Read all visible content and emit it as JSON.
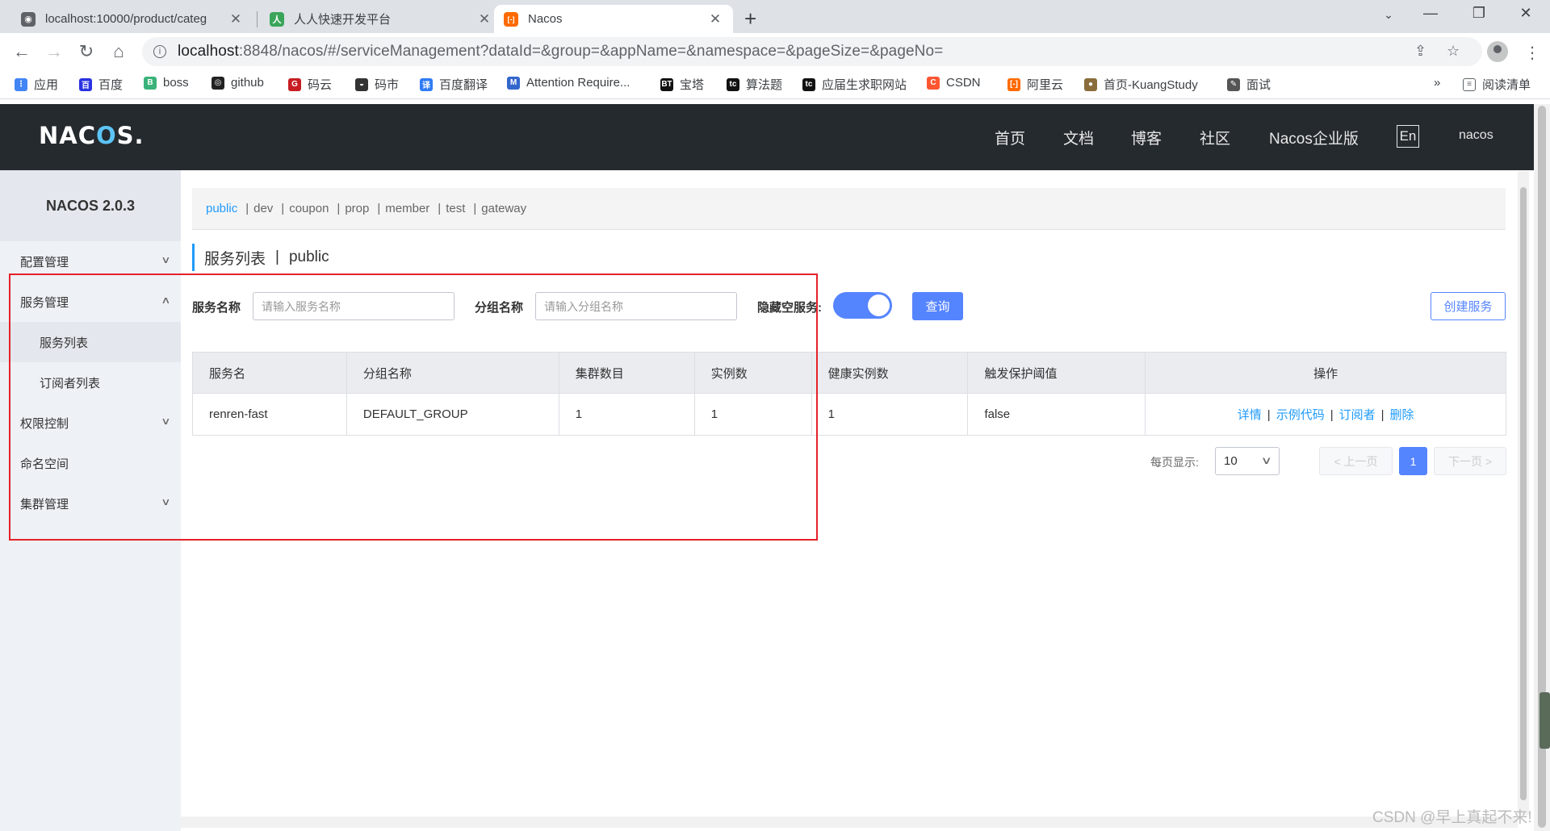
{
  "browser": {
    "tabs": [
      {
        "title": "localhost:10000/product/categ",
        "fav_color": "#5f6368",
        "fav_glyph": "◉"
      },
      {
        "title": "人人快速开发平台",
        "fav_color": "#3aa55a",
        "fav_glyph": "人"
      },
      {
        "title": "Nacos",
        "fav_color": "#ff6a00",
        "fav_glyph": "[-]"
      }
    ],
    "url_host": "localhost",
    "url_rest": ":8848/nacos/#/serviceManagement?dataId=&group=&appName=&namespace=&pageSize=&pageNo=",
    "bookmarks": [
      {
        "label": "应用",
        "color": "#4285f4",
        "glyph": "⋮"
      },
      {
        "label": "百度",
        "color": "#2932e1",
        "glyph": "百"
      },
      {
        "label": "boss",
        "color": "#3ab27a",
        "glyph": "B"
      },
      {
        "label": "github",
        "color": "#222222",
        "glyph": "◎"
      },
      {
        "label": "码云",
        "color": "#c71d23",
        "glyph": "G"
      },
      {
        "label": "码市",
        "color": "#333333",
        "glyph": "◒"
      },
      {
        "label": "百度翻译",
        "color": "#2f7cf6",
        "glyph": "译"
      },
      {
        "label": "Attention Require...",
        "color": "#3366cc",
        "glyph": "M"
      },
      {
        "label": "宝塔",
        "color": "#111111",
        "glyph": "BT"
      },
      {
        "label": "算法题",
        "color": "#111111",
        "glyph": "tc"
      },
      {
        "label": "应届生求职网站",
        "color": "#111111",
        "glyph": "tc"
      },
      {
        "label": "CSDN",
        "color": "#fc5531",
        "glyph": "C"
      },
      {
        "label": "阿里云",
        "color": "#ff6a00",
        "glyph": "[-]"
      },
      {
        "label": "首页-KuangStudy",
        "color": "#8a6d3b",
        "glyph": "●"
      },
      {
        "label": "面试",
        "color": "#555555",
        "glyph": "✎"
      }
    ],
    "reading_list": "阅读清单",
    "more": "»"
  },
  "nacos": {
    "logo": "NACOS.",
    "menu": [
      "首页",
      "文档",
      "博客",
      "社区",
      "Nacos企业版"
    ],
    "lang": "En",
    "user": "nacos",
    "version": "NACOS 2.0.3",
    "sidebar": [
      {
        "label": "配置管理",
        "arrow": "∨"
      },
      {
        "label": "服务管理",
        "arrow": "∧"
      },
      {
        "label": "服务列表",
        "arrow": ""
      },
      {
        "label": "订阅者列表",
        "arrow": ""
      },
      {
        "label": "权限控制",
        "arrow": "∨"
      },
      {
        "label": "命名空间",
        "arrow": ""
      },
      {
        "label": "集群管理",
        "arrow": "∨"
      }
    ],
    "namespaces": [
      "public",
      "dev",
      "coupon",
      "prop",
      "member",
      "test",
      "gateway"
    ],
    "page_title": "服务列表",
    "page_ns": "public",
    "filters": {
      "service_label": "服务名称",
      "service_placeholder": "请输入服务名称",
      "group_label": "分组名称",
      "group_placeholder": "请输入分组名称",
      "hide_empty_label": "隐藏空服务:",
      "query_btn": "查询",
      "create_btn": "创建服务"
    },
    "table": {
      "headers": [
        "服务名",
        "分组名称",
        "集群数目",
        "实例数",
        "健康实例数",
        "触发保护阈值",
        "操作"
      ],
      "rows": [
        {
          "name": "renren-fast",
          "group": "DEFAULT_GROUP",
          "clusters": "1",
          "instances": "1",
          "healthy": "1",
          "threshold": "false",
          "ops": [
            "详情",
            "示例代码",
            "订阅者",
            "删除"
          ]
        }
      ]
    },
    "pager": {
      "per_page_label": "每页显示:",
      "per_page": "10",
      "prev": "< 上一页",
      "current": "1",
      "next": "下一页 >"
    },
    "watermark": "CSDN @早上真起不来!"
  }
}
